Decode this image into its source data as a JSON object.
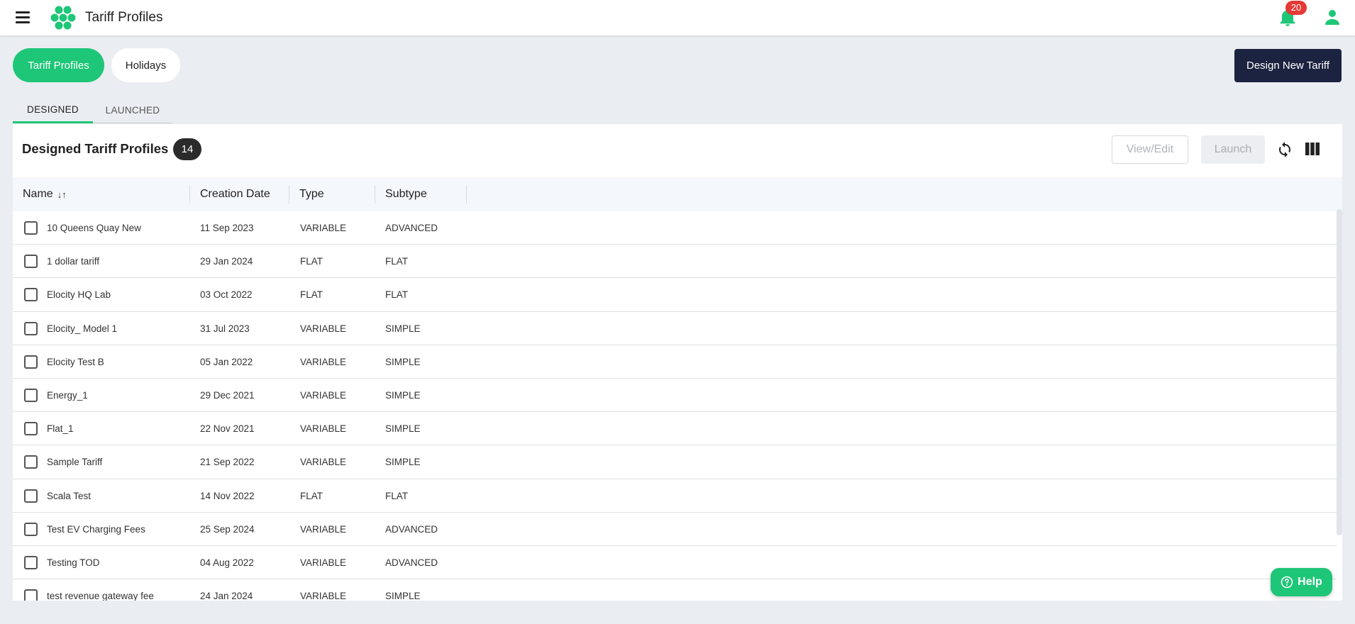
{
  "header": {
    "title": "Tariff Profiles",
    "notification_count": "20"
  },
  "pills": {
    "active": "Tariff Profiles",
    "inactive": "Holidays"
  },
  "actions": {
    "design_new": "Design New Tariff"
  },
  "tabs": {
    "designed": "DESIGNED",
    "launched": "LAUNCHED"
  },
  "panel": {
    "title": "Designed Tariff Profiles",
    "count": "14",
    "view_edit": "View/Edit",
    "launch": "Launch"
  },
  "table": {
    "columns": {
      "name": "Name",
      "creation_date": "Creation Date",
      "type": "Type",
      "subtype": "Subtype"
    },
    "rows": [
      {
        "name": "10 Queens Quay New",
        "date": "11 Sep 2023",
        "type": "VARIABLE",
        "subtype": "ADVANCED"
      },
      {
        "name": "1 dollar tariff",
        "date": "29 Jan 2024",
        "type": "FLAT",
        "subtype": "FLAT"
      },
      {
        "name": "Elocity HQ Lab",
        "date": "03 Oct 2022",
        "type": "FLAT",
        "subtype": "FLAT"
      },
      {
        "name": "Elocity_ Model 1",
        "date": "31 Jul 2023",
        "type": "VARIABLE",
        "subtype": "SIMPLE"
      },
      {
        "name": "Elocity Test B",
        "date": "05 Jan 2022",
        "type": "VARIABLE",
        "subtype": "SIMPLE"
      },
      {
        "name": "Energy_1",
        "date": "29 Dec 2021",
        "type": "VARIABLE",
        "subtype": "SIMPLE"
      },
      {
        "name": "Flat_1",
        "date": "22 Nov 2021",
        "type": "VARIABLE",
        "subtype": "SIMPLE"
      },
      {
        "name": "Sample Tariff",
        "date": "21 Sep 2022",
        "type": "VARIABLE",
        "subtype": "SIMPLE"
      },
      {
        "name": "Scala Test",
        "date": "14 Nov 2022",
        "type": "FLAT",
        "subtype": "FLAT"
      },
      {
        "name": "Test EV Charging Fees",
        "date": "25 Sep 2024",
        "type": "VARIABLE",
        "subtype": "ADVANCED"
      },
      {
        "name": "Testing TOD",
        "date": "04 Aug 2022",
        "type": "VARIABLE",
        "subtype": "ADVANCED"
      },
      {
        "name": "test revenue gateway fee",
        "date": "24 Jan 2024",
        "type": "VARIABLE",
        "subtype": "SIMPLE"
      }
    ]
  },
  "help": {
    "label": "Help"
  },
  "colors": {
    "accent": "#1ec677",
    "primary_dark": "#1c2340",
    "badge_red": "#e53935"
  }
}
